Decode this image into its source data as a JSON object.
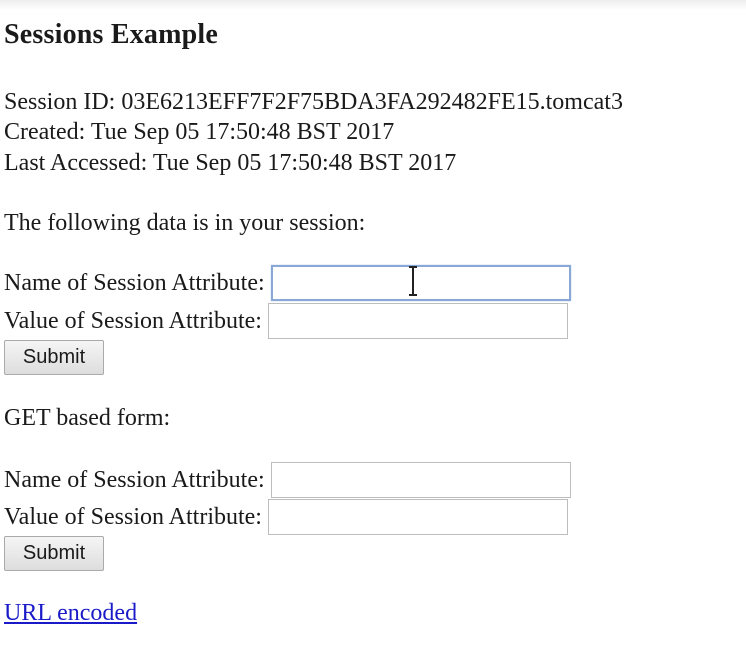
{
  "title": "Sessions Example",
  "session": {
    "id_line": "Session ID: 03E6213EFF7F2F75BDA3FA292482FE15.tomcat3",
    "created_line": "Created: Tue Sep 05 17:50:48 BST 2017",
    "last_accessed_line": "Last Accessed: Tue Sep 05 17:50:48 BST 2017"
  },
  "data_intro": "The following data is in your session:",
  "post_form": {
    "name_label": "Name of Session Attribute:",
    "name_value": "",
    "value_label": "Value of Session Attribute:",
    "value_value": "",
    "submit_label": "Submit"
  },
  "get_form_heading": "GET based form:",
  "get_form": {
    "name_label": "Name of Session Attribute:",
    "name_value": "",
    "value_label": "Value of Session Attribute:",
    "value_value": "",
    "submit_label": "Submit"
  },
  "url_encoded_link": "URL encoded",
  "colors": {
    "link": "#1a1ac8",
    "focus_border": "#8aa8d6"
  }
}
